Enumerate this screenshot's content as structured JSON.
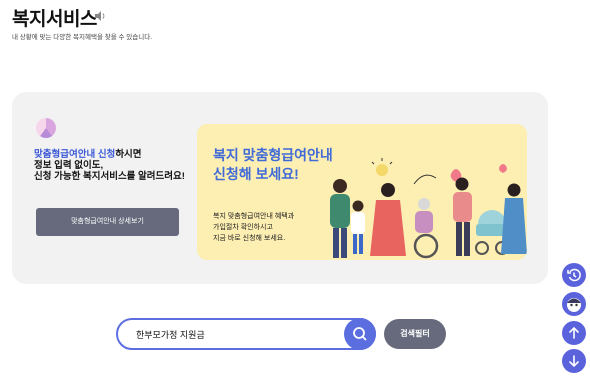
{
  "header": {
    "title": "복지서비스",
    "subtitle": "내 상황에 맞는 다양한 복지혜택을 찾을 수 있습니다."
  },
  "promo": {
    "highlight": "맞춤형급여안내 신청",
    "line1_rest": "하시면",
    "line2": "정보 입력 없이도,",
    "line3": "신청 가능한 복지서비스를 알려드려요!",
    "detail_button": "맞춤형급여안내 상세보기"
  },
  "banner": {
    "headline1": "복지 맞춤형급여안내",
    "headline2": "신청해 보세요!",
    "body1": "복지 맞춤형급여안내 혜택과",
    "body2": "가입절차 확인하시고",
    "body3": "지금 바로 신청해 보세요."
  },
  "search": {
    "value": "한부모가정 지원금",
    "filter_button": "검색필터"
  },
  "colors": {
    "accent": "#5a6ee0",
    "highlight_text": "#3b58d6",
    "banner_bg": "#fdeeb2",
    "button_gray": "#666a7c"
  },
  "icons": [
    "speaker-icon",
    "pie-chart-icon",
    "search-icon",
    "history-icon",
    "mascot-icon",
    "arrow-up-icon",
    "arrow-down-icon"
  ]
}
